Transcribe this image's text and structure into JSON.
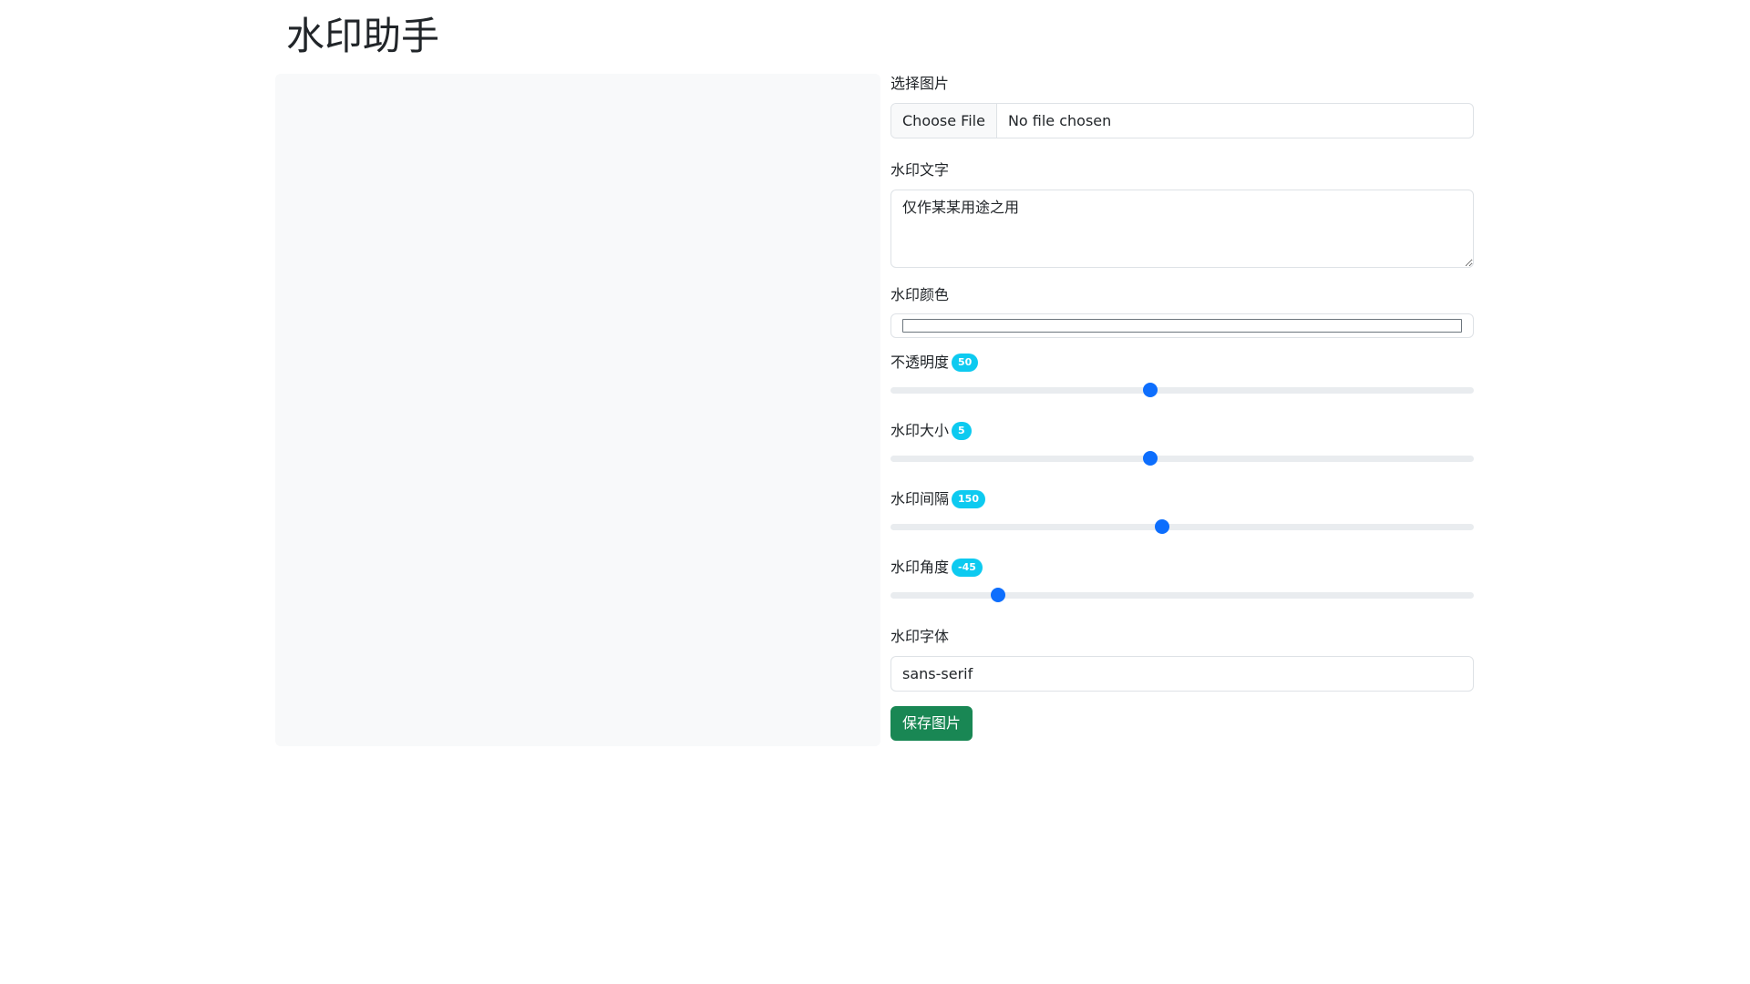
{
  "header": {
    "title": "水印助手"
  },
  "form": {
    "file": {
      "label": "选择图片",
      "button": "Choose File",
      "status": "No file chosen"
    },
    "text": {
      "label": "水印文字",
      "value": "仅作某某用途之用"
    },
    "color": {
      "label": "水印颜色",
      "value": "#ffffff"
    },
    "opacity": {
      "label": "不透明度",
      "value": "50",
      "fraction": 0.445
    },
    "size": {
      "label": "水印大小",
      "value": "5",
      "fraction": 0.445
    },
    "spacing": {
      "label": "水印间隔",
      "value": "150",
      "fraction": 0.465
    },
    "angle": {
      "label": "水印角度",
      "value": "-45",
      "fraction": 0.185
    },
    "font": {
      "label": "水印字体",
      "value": "sans-serif"
    },
    "save_label": "保存图片"
  },
  "colors": {
    "badge": "#0dcaf0",
    "slider": "#0d6efd",
    "save": "#198754",
    "preview_bg": "#f8f9fa"
  }
}
